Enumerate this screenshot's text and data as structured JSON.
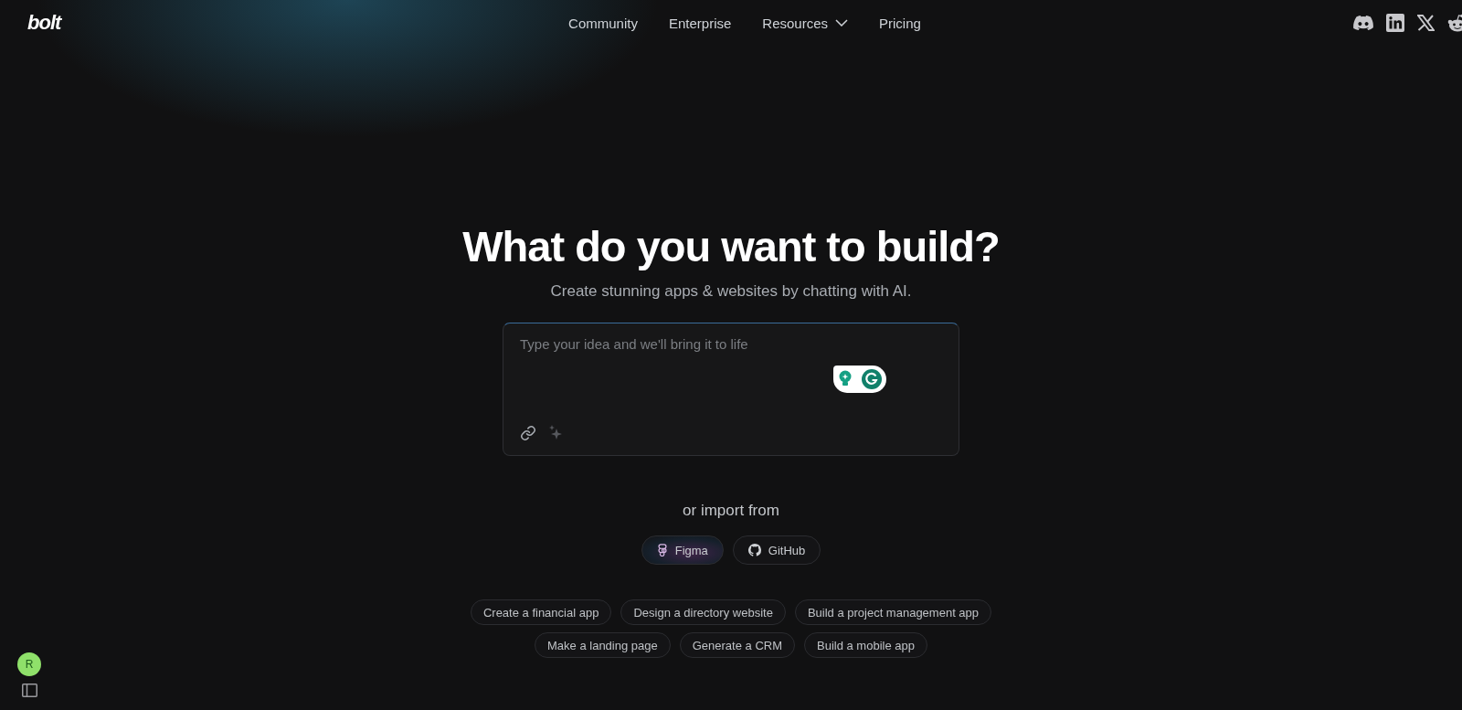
{
  "header": {
    "logo": "bolt",
    "nav": [
      {
        "label": "Community",
        "kind": "link"
      },
      {
        "label": "Enterprise",
        "kind": "link"
      },
      {
        "label": "Resources",
        "kind": "dropdown"
      },
      {
        "label": "Pricing",
        "kind": "link"
      }
    ]
  },
  "hero": {
    "title": "What do you want to build?",
    "subtitle": "Create stunning apps & websites by chatting with AI."
  },
  "prompt": {
    "placeholder": "Type your idea and we'll bring it to life"
  },
  "import": {
    "label": "or import from",
    "sources": [
      {
        "label": "Figma",
        "kind": "figma"
      },
      {
        "label": "GitHub",
        "kind": "github"
      }
    ]
  },
  "suggestions": [
    [
      "Create a financial app",
      "Design a directory website",
      "Build a project management app"
    ],
    [
      "Make a landing page",
      "Generate a CRM",
      "Build a mobile app"
    ]
  ],
  "user": {
    "initial": "R"
  }
}
